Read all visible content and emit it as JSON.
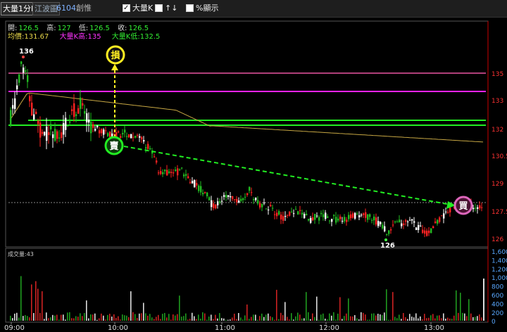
{
  "toolbar": {
    "interval": "大量1分K",
    "wave_button": "江波圖",
    "stock_code": "6104",
    "stock_name": "創惟",
    "big_k_label": "大量K",
    "big_k_checked": true,
    "opt2_label": "↑↓",
    "pct_label": "%顯示",
    "pct_checked": false
  },
  "quote": {
    "open_label": "開:",
    "open": "126.5",
    "high_label": "高:",
    "high": "127",
    "low_label": "低:",
    "low": "126.5",
    "close_label": "收:",
    "close": "126.5",
    "avg_label": "均價:",
    "avg": "131.67",
    "bigk_high_label": "大量K高:",
    "bigk_high": "135",
    "bigk_low_label": "大量K低:",
    "bigk_low": "132.5"
  },
  "chart_data": {
    "type": "candlestick",
    "x_ticks": [
      "09:00",
      "10:00",
      "11:00",
      "12:00",
      "13:00"
    ],
    "y_ticks": [
      "135",
      "133",
      "132",
      "130.5",
      "129",
      "127.5",
      "126"
    ],
    "ylim": [
      125.5,
      136.5
    ],
    "volume_label": "成交量:43",
    "volume_ticks": [
      "1,600",
      "1,400",
      "1,200",
      "1,000",
      "800",
      "600",
      "400",
      "200",
      "0"
    ],
    "volume_max": 1600,
    "high_marker": "136",
    "low_marker": "126",
    "levels": [
      {
        "name": "大量K高",
        "value": 134.1,
        "color": "#ff22ff"
      },
      {
        "name": "大量K低",
        "value": 132.1,
        "color": "#22ee22"
      },
      {
        "name": "level",
        "value": 132.45,
        "color": "#22ee22"
      },
      {
        "name": "level",
        "value": 135.1,
        "color": "#b0407a"
      },
      {
        "name": "level",
        "value": 127.8,
        "color": "#888888"
      }
    ],
    "signals": [
      {
        "label": "損",
        "type": "stop",
        "color": "#ffee22"
      },
      {
        "label": "賣",
        "type": "sell",
        "color": "#22cc33"
      },
      {
        "label": "買",
        "type": "buy",
        "color": "#dd66bb"
      }
    ],
    "colors": {
      "up": "#ff2222",
      "down": "#22bb22",
      "flat": "#ffffff",
      "avg": "#c8a844"
    }
  }
}
